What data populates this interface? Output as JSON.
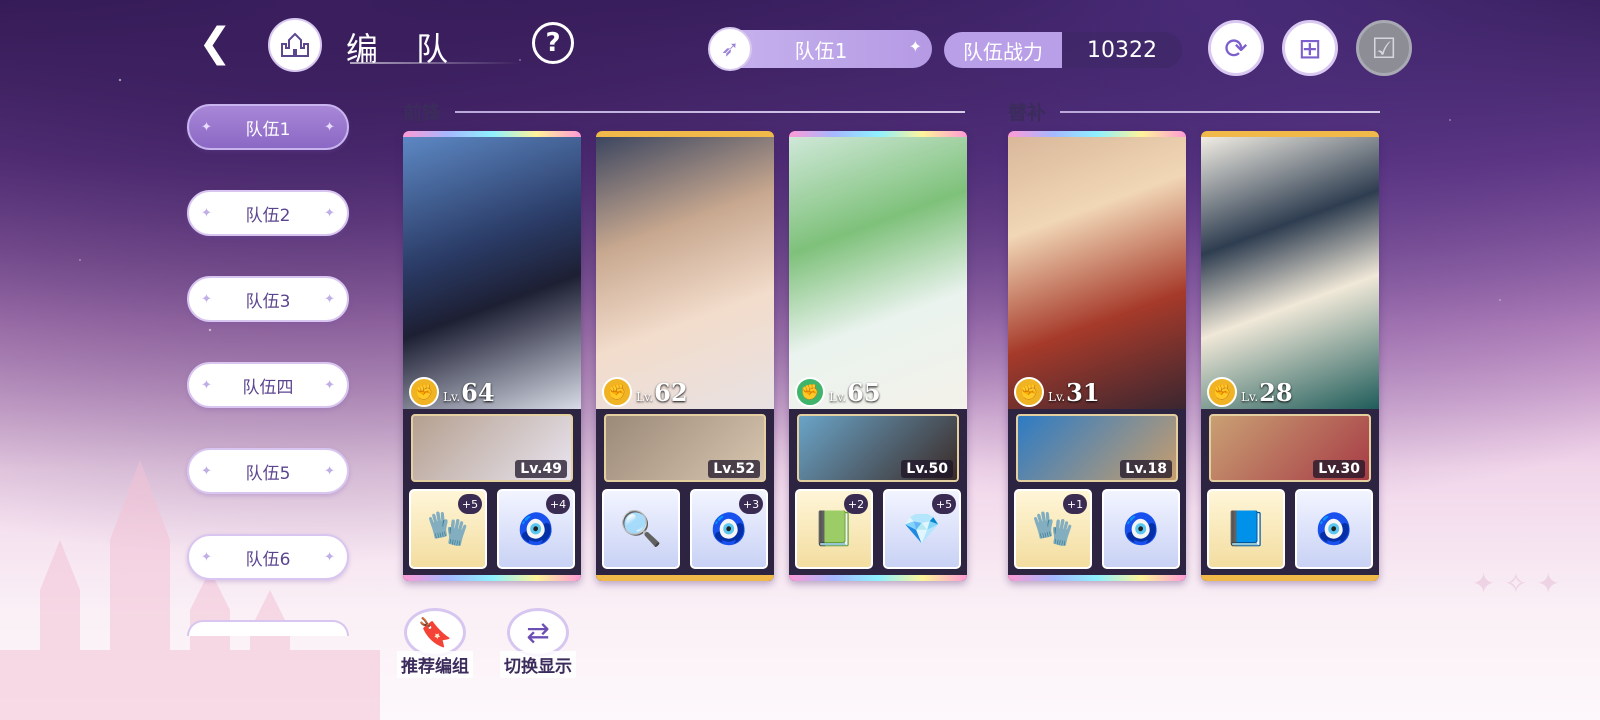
{
  "header": {
    "title": "编 队",
    "help_label": "?",
    "current_team": "队伍1",
    "power_label": "队伍战力",
    "power_value": "10322"
  },
  "sidebar": {
    "items": [
      {
        "label": "队伍1",
        "active": true
      },
      {
        "label": "队伍2",
        "active": false
      },
      {
        "label": "队伍3",
        "active": false
      },
      {
        "label": "队伍四",
        "active": false
      },
      {
        "label": "队伍5",
        "active": false
      },
      {
        "label": "队伍6",
        "active": false
      },
      {
        "label": "",
        "active": false
      }
    ]
  },
  "sections": {
    "front": "前锋",
    "bench": "替补"
  },
  "cards": [
    {
      "lv_prefix": "Lv.",
      "level": "64",
      "element": "gold",
      "sub_level": "Lv.49",
      "equip": [
        {
          "plus": "+5"
        },
        {
          "plus": "+4"
        }
      ],
      "frame": "rainbow"
    },
    {
      "lv_prefix": "Lv.",
      "level": "62",
      "element": "gold",
      "sub_level": "Lv.52",
      "equip": [
        {
          "plus": ""
        },
        {
          "plus": "+3"
        }
      ],
      "frame": "gold"
    },
    {
      "lv_prefix": "Lv.",
      "level": "65",
      "element": "green",
      "sub_level": "Lv.50",
      "equip": [
        {
          "plus": "+2"
        },
        {
          "plus": "+5"
        }
      ],
      "frame": "rainbow"
    },
    {
      "lv_prefix": "Lv.",
      "level": "31",
      "element": "gold",
      "sub_level": "Lv.18",
      "equip": [
        {
          "plus": "+1"
        },
        {
          "plus": ""
        }
      ],
      "frame": "rainbow"
    },
    {
      "lv_prefix": "Lv.",
      "level": "28",
      "element": "gold",
      "sub_level": "Lv.30",
      "equip": [
        {
          "plus": ""
        },
        {
          "plus": ""
        }
      ],
      "frame": "gold"
    }
  ],
  "bottom": {
    "recommend": "推荐编组",
    "switch": "切换显示"
  },
  "colors": {
    "accent": "#8b68c4",
    "gold_frame": "#f1b94a",
    "element_gold": "#f0b323",
    "element_green": "#3fb56b"
  }
}
